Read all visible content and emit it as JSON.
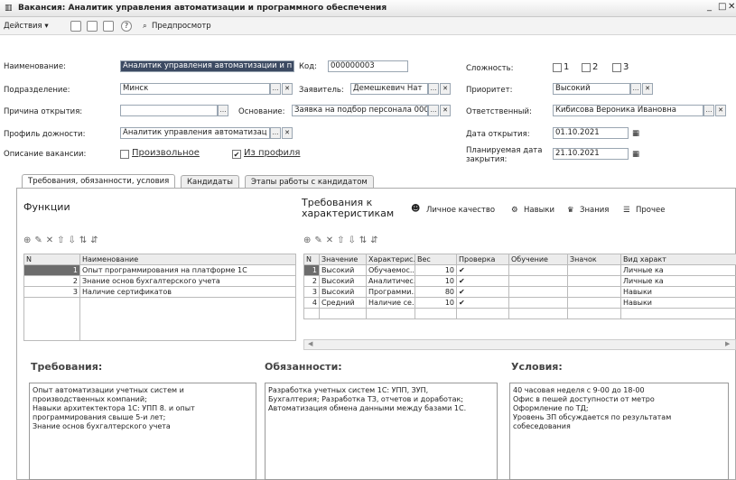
{
  "window": {
    "title": "Вакансия: Аналитик управления автоматизации и программного обеспечения"
  },
  "toolbar": {
    "actions_label": "Действия ▾",
    "preview_label": "Предпросмотр"
  },
  "form": {
    "name_label": "Наименование:",
    "name_value": "Аналитик управления автоматизации и п",
    "code_label": "Код:",
    "code_value": "000000003",
    "complexity_label": "Сложность:",
    "complexity_options": [
      "1",
      "2",
      "3"
    ],
    "division_label": "Подразделение:",
    "division_value": "Минск",
    "applicant_label": "Заявитель:",
    "applicant_value": "Демешкевич Нат",
    "priority_label": "Приоритет:",
    "priority_value": "Высокий",
    "reason_label": "Причина открытия:",
    "reason_value": "",
    "basis_label": "Основание:",
    "basis_value": "Заявка на подбор персонала 000",
    "responsible_label": "Ответственный:",
    "responsible_value": "Кибисова Вероника Ивановна",
    "profile_label": "Профиль дожности:",
    "profile_value": "Аналитик управления автоматизац",
    "open_date_label": "Дата открытия:",
    "open_date_value": "01.10.2021",
    "desc_label": "Описание вакансии:",
    "desc_opt1": "Произвольное",
    "desc_opt2": "Из профиля",
    "close_date_label": "Планируемая дата закрытия:",
    "close_date_value": "21.10.2021"
  },
  "tabs": [
    "Требования, обязанности, условия",
    "Кандидаты",
    "Этапы работы с кандидатом"
  ],
  "functions": {
    "title": "Функции",
    "headers": [
      "N",
      "Наименование"
    ],
    "rows": [
      {
        "n": "1",
        "name": "Опыт программирования на платформе 1С"
      },
      {
        "n": "2",
        "name": "Знание основ бухгалтерского учета"
      },
      {
        "n": "3",
        "name": "Наличие сертификатов"
      }
    ]
  },
  "requirements": {
    "title": "Требования к характеристикам",
    "filters": [
      "Личное качество",
      "Навыки",
      "Знания",
      "Прочее"
    ],
    "headers": [
      "N",
      "Значение",
      "Характерис...",
      "Вес",
      "Проверка",
      "Обучение",
      "Значок",
      "Вид характ"
    ],
    "rows": [
      {
        "n": "1",
        "value": "Высокий",
        "char": "Обучаемос...",
        "weight": "10",
        "check": "✔",
        "training": "",
        "icon": "",
        "kind": "Личные ка"
      },
      {
        "n": "2",
        "value": "Высокий",
        "char": "Аналитичес...",
        "weight": "10",
        "check": "✔",
        "training": "",
        "icon": "",
        "kind": "Личные ка"
      },
      {
        "n": "3",
        "value": "Высокий",
        "char": "Программи...",
        "weight": "80",
        "check": "✔",
        "training": "",
        "icon": "",
        "kind": "Навыки"
      },
      {
        "n": "4",
        "value": "Средний",
        "char": "Наличие се...",
        "weight": "10",
        "check": "✔",
        "training": "",
        "icon": "",
        "kind": "Навыки"
      }
    ]
  },
  "bottom": {
    "req_title": "Требования:",
    "req_text": "Опыт автоматизации учетных систем и\nпроизводственных компаний;\nНавыки архитектектора 1С: УПП 8. и опыт\nпрограммирования свыше 5-и лет;\nЗнание основ бухгалтерского учета",
    "duty_title": "Обязанности:",
    "duty_text": "Разработка учетных систем 1С: УПП, ЗУП,\nБухгалтерия; Разработка ТЗ, отчетов и доработак;\nАвтоматизация обмена данными между базами 1С.",
    "cond_title": "Условия:",
    "cond_text": "40 часовая неделя с 9-00 до 18-00\nОфис в пешей доступности от метро\nОформление по ТД;\nУровень ЗП обсуждается по результатам\nсобеседования"
  },
  "colors": {
    "selected_row": "#6c6c6c",
    "selected_field": "#3c4a62"
  }
}
